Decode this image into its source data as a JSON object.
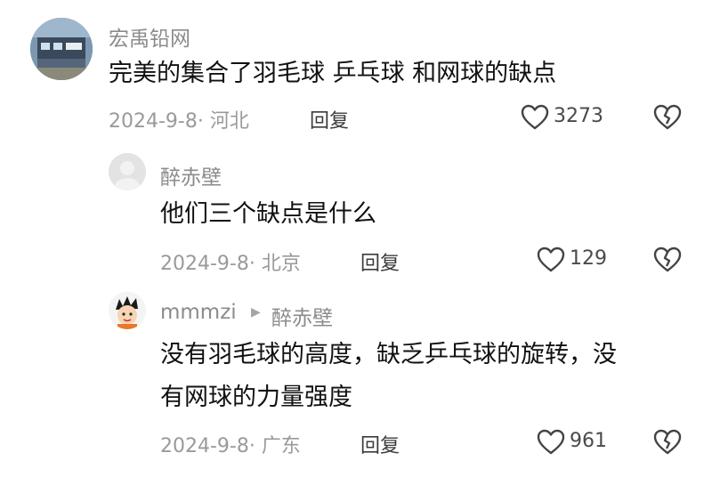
{
  "comments": [
    {
      "username": "宏禹铅网",
      "text": "完美的集合了羽毛球  乒乓球  和网球的缺点",
      "meta": "2024-9-8· 河北",
      "reply_label": "回复",
      "likes": "3273"
    },
    {
      "username": "醉赤壁",
      "text": "他们三个缺点是什么",
      "meta": "2024-9-8· 北京",
      "reply_label": "回复",
      "likes": "129"
    },
    {
      "username": "mmmzi",
      "reply_to": "醉赤壁",
      "text_line1": "没有羽毛球的高度，缺乏乒乓球的旋转，没",
      "text_line2": "有网球的力量强度",
      "meta": "2024-9-8· 广东",
      "reply_label": "回复",
      "likes": "961"
    }
  ]
}
